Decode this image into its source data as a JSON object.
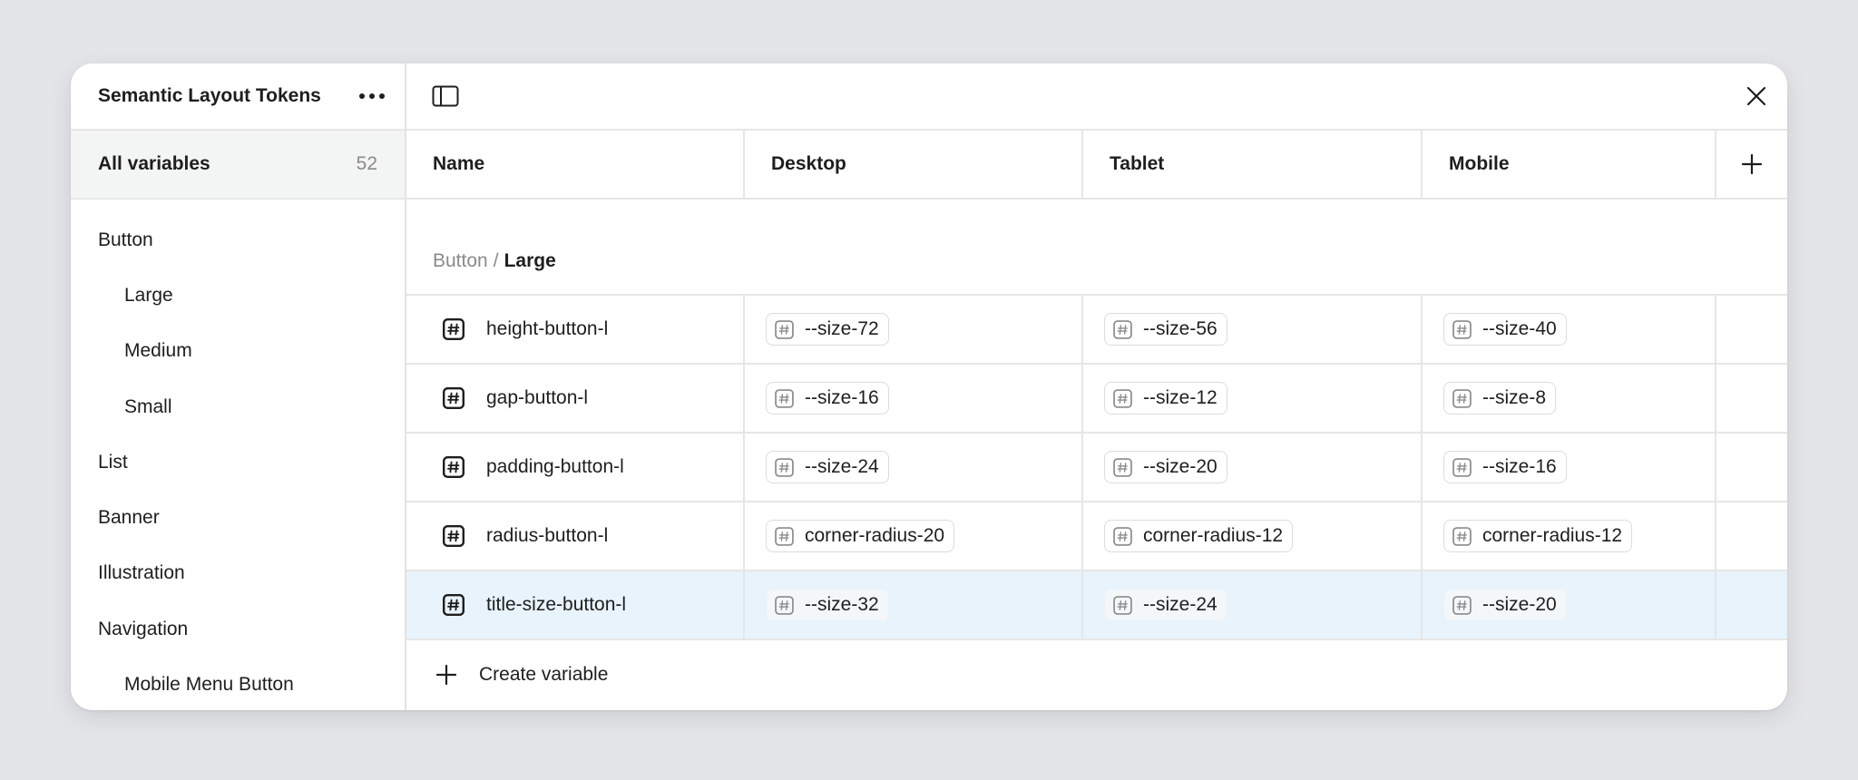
{
  "sidebar": {
    "title": "Semantic Layout Tokens",
    "more_icon": "more-horizontal-icon",
    "all_variables": {
      "label": "All variables",
      "count": "52"
    },
    "groups": [
      {
        "label": "Button",
        "level": 0
      },
      {
        "label": "Large",
        "level": 1
      },
      {
        "label": "Medium",
        "level": 1
      },
      {
        "label": "Small",
        "level": 1
      },
      {
        "label": "List",
        "level": 0
      },
      {
        "label": "Banner",
        "level": 0
      },
      {
        "label": "Illustration",
        "level": 0
      },
      {
        "label": "Navigation",
        "level": 0
      },
      {
        "label": "Mobile Menu Button",
        "level": 1
      }
    ]
  },
  "toolbar": {
    "toggle_icon": "sidebar-toggle-icon",
    "close_icon": "close-icon"
  },
  "table": {
    "columns": [
      "Name",
      "Desktop",
      "Tablet",
      "Mobile"
    ],
    "add_mode_icon": "plus-icon",
    "group_path": {
      "parent": "Button",
      "separator": "/",
      "current": "Large"
    },
    "rows": [
      {
        "name": "height-button-l",
        "desktop": "--size-72",
        "tablet": "--size-56",
        "mobile": "--size-40",
        "selected": false
      },
      {
        "name": "gap-button-l",
        "desktop": "--size-16",
        "tablet": "--size-12",
        "mobile": "--size-8",
        "selected": false
      },
      {
        "name": "padding-button-l",
        "desktop": "--size-24",
        "tablet": "--size-20",
        "mobile": "--size-16",
        "selected": false
      },
      {
        "name": "radius-button-l",
        "desktop": "corner-radius-20",
        "tablet": "corner-radius-12",
        "mobile": "corner-radius-12",
        "selected": false
      },
      {
        "name": "title-size-button-l",
        "desktop": "--size-32",
        "tablet": "--size-24",
        "mobile": "--size-20",
        "selected": true
      }
    ],
    "variable_type_icon": "number-hash-icon",
    "create_label": "Create variable"
  },
  "colors": {
    "background": "#e4e5e9",
    "selected_row": "#e8f3fc",
    "active_nav": "#f3f4f4",
    "muted_text": "#8a8a8a"
  }
}
